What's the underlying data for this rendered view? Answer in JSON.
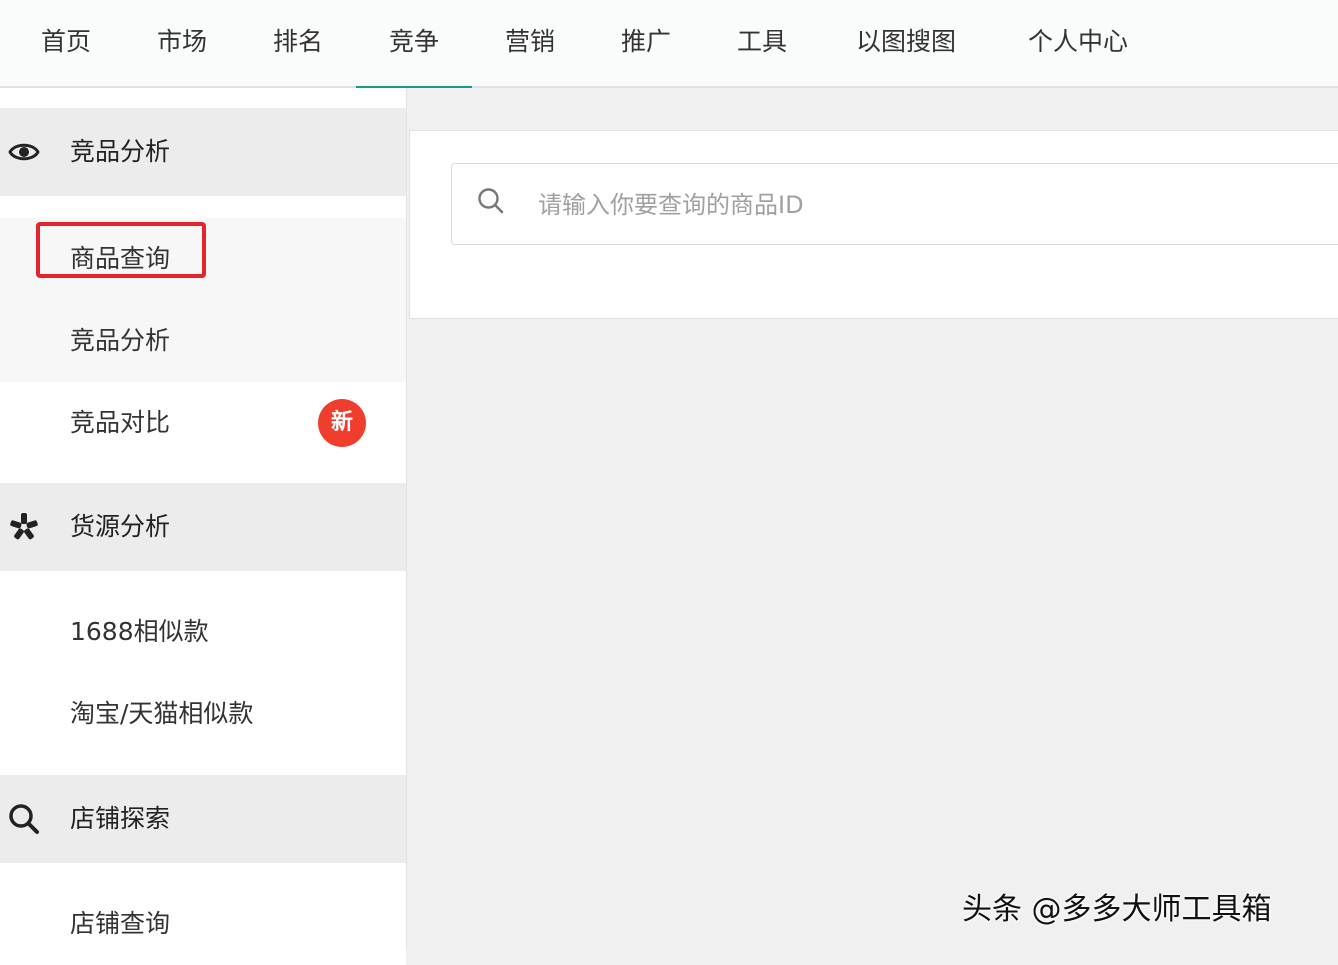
{
  "nav": {
    "items": [
      {
        "label": "首页"
      },
      {
        "label": "市场"
      },
      {
        "label": "排名"
      },
      {
        "label": "竞争",
        "active": true
      },
      {
        "label": "营销"
      },
      {
        "label": "推广"
      },
      {
        "label": "工具"
      },
      {
        "label": "以图搜图"
      },
      {
        "label": "个人中心"
      }
    ],
    "active_color": "#1a9a8d"
  },
  "sidebar": {
    "sections": [
      {
        "label": "竞品分析",
        "icon": "eye-icon",
        "items": [
          {
            "label": "商品查询",
            "highlighted": true
          },
          {
            "label": "竞品分析"
          },
          {
            "label": "竞品对比",
            "badge": "新"
          }
        ]
      },
      {
        "label": "货源分析",
        "icon": "pinwheel-icon",
        "items": [
          {
            "label": "1688相似款"
          },
          {
            "label": "淘宝/天猫相似款"
          }
        ]
      },
      {
        "label": "店铺探索",
        "icon": "search-icon",
        "items": [
          {
            "label": "店铺查询"
          }
        ]
      }
    ],
    "highlight_color": "#e4252d",
    "badge_color": "#f03e2e"
  },
  "search": {
    "placeholder": "请输入你要查询的商品ID",
    "value": ""
  },
  "watermark": "头条 @多多大师工具箱"
}
